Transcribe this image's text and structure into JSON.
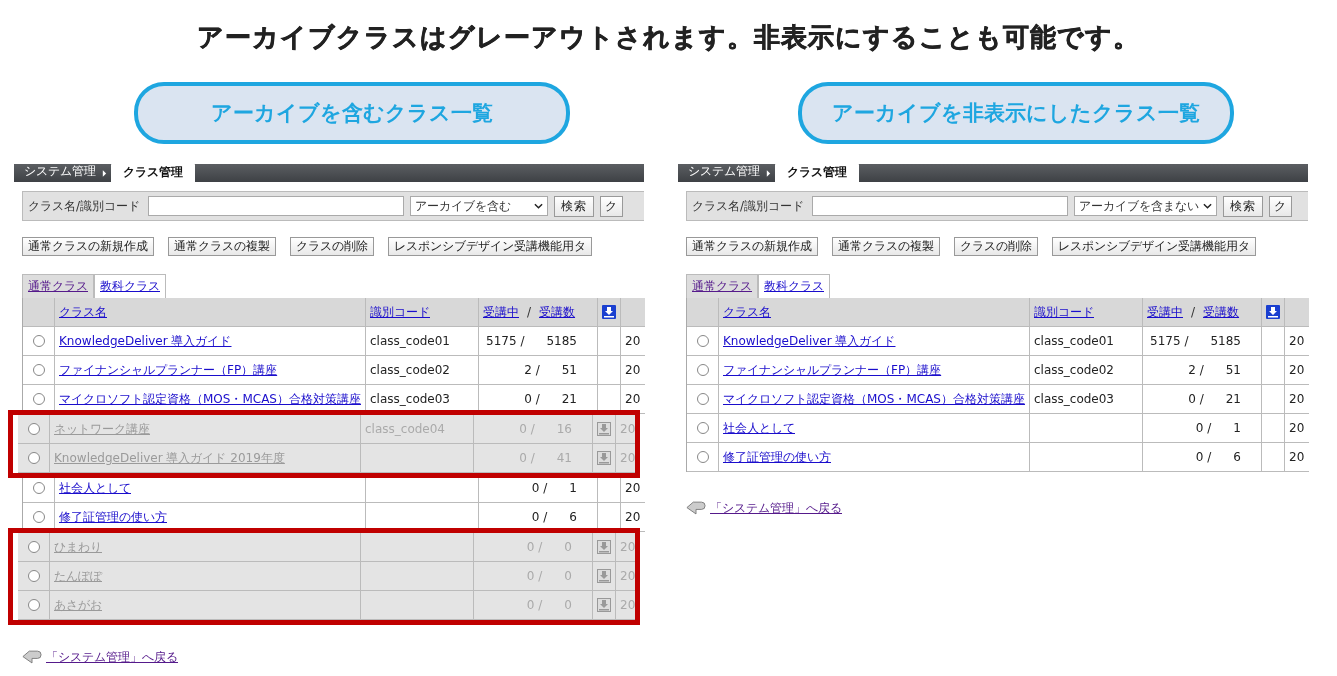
{
  "heading": "アーカイブクラスはグレーアウトされます。非表示にすることも可能です。",
  "panels": [
    {
      "caption": "アーカイブを含むクラス一覧",
      "breadcrumb": [
        {
          "label": "システム管理",
          "selected": false
        },
        {
          "label": "クラス管理",
          "selected": true
        }
      ],
      "search": {
        "label": "クラス名/識別コード",
        "filter": "アーカイブを含む",
        "button": "検索",
        "button_cut": "ク"
      },
      "actions": [
        "通常クラスの新規作成",
        "通常クラスの複製",
        "クラスの削除",
        "レスポンシブデザイン受講機能用タ"
      ],
      "tabs": [
        {
          "label": "通常クラス",
          "selected": false
        },
        {
          "label": "教科クラス",
          "selected": true
        }
      ],
      "columns": {
        "name": "クラス名",
        "code": "識別コード",
        "enrolled": "受講中",
        "separator": "/",
        "total": "受講数"
      },
      "rows": [
        {
          "selected": false,
          "archived": false,
          "name": "KnowledgeDeliver 導入ガイド",
          "code": "class_code01",
          "enrolled": "5175 /",
          "total": "5185",
          "column_6": "20"
        },
        {
          "selected": false,
          "archived": false,
          "name": "ファイナンシャルプランナー（FP）講座",
          "code": "class_code02",
          "enrolled": "2 /",
          "total": "51",
          "column_6": "20"
        },
        {
          "selected": false,
          "archived": false,
          "name": "マイクロソフト認定資格（MOS・MCAS）合格対策講座",
          "code": "class_code03",
          "enrolled": "0 /",
          "total": "21",
          "column_6": "20"
        },
        {
          "selected": false,
          "archived": true,
          "name": "ネットワーク講座",
          "code": "class_code04",
          "enrolled": "0 /",
          "total": "16",
          "column_6": "20"
        },
        {
          "selected": false,
          "archived": true,
          "name": "KnowledgeDeliver 導入ガイド  2019年度",
          "enrolled": "0 /",
          "total": "41",
          "column_6": "20"
        },
        {
          "selected": false,
          "archived": false,
          "name": "社会人として",
          "enrolled": "0 /",
          "total": "1",
          "column_6": "20"
        },
        {
          "selected": false,
          "archived": false,
          "name": "修了証管理の使い方",
          "enrolled": "0 /",
          "total": "6",
          "column_6": "20"
        },
        {
          "selected": false,
          "archived": true,
          "name": "ひまわり",
          "enrolled": "0 /",
          "total": "0",
          "column_6": "20"
        },
        {
          "selected": false,
          "archived": true,
          "name": "たんぽぽ",
          "enrolled": "0 /",
          "total": "0",
          "column_6": "20"
        },
        {
          "selected": false,
          "archived": true,
          "name": "あさがお",
          "enrolled": "0 /",
          "total": "0",
          "column_6": "20"
        }
      ],
      "back_link": "「システム管理」へ戻る"
    },
    {
      "caption": "アーカイブを非表示にしたクラス一覧",
      "breadcrumb": [
        {
          "label": "システム管理",
          "selected": false
        },
        {
          "label": "クラス管理",
          "selected": true
        }
      ],
      "search": {
        "label": "クラス名/識別コード",
        "filter": "アーカイブを含まない",
        "button": "検索",
        "button_cut": "ク"
      },
      "actions": [
        "通常クラスの新規作成",
        "通常クラスの複製",
        "クラスの削除",
        "レスポンシブデザイン受講機能用タ"
      ],
      "tabs": [
        {
          "label": "通常クラス",
          "selected": false
        },
        {
          "label": "教科クラス",
          "selected": true
        }
      ],
      "columns": {
        "name": "クラス名",
        "code": "識別コード",
        "enrolled": "受講中",
        "separator": "/",
        "total": "受講数"
      },
      "rows": [
        {
          "selected": false,
          "archived": false,
          "name": "KnowledgeDeliver 導入ガイド",
          "code": "class_code01",
          "enrolled": "5175 /",
          "total": "5185",
          "column_6": "20"
        },
        {
          "selected": false,
          "archived": false,
          "name": "ファイナンシャルプランナー（FP）講座",
          "code": "class_code02",
          "enrolled": "2 /",
          "total": "51",
          "column_6": "20"
        },
        {
          "selected": false,
          "archived": false,
          "name": "マイクロソフト認定資格（MOS・MCAS）合格対策講座",
          "code": "class_code03",
          "enrolled": "0 /",
          "total": "21",
          "column_6": "20"
        },
        {
          "selected": false,
          "archived": false,
          "name": "社会人として",
          "enrolled": "0 /",
          "total": "1",
          "column_6": "20"
        },
        {
          "selected": false,
          "archived": false,
          "name": "修了証管理の使い方",
          "enrolled": "0 /",
          "total": "6",
          "column_6": "20"
        }
      ],
      "back_link": "「システム管理」へ戻る"
    }
  ]
}
